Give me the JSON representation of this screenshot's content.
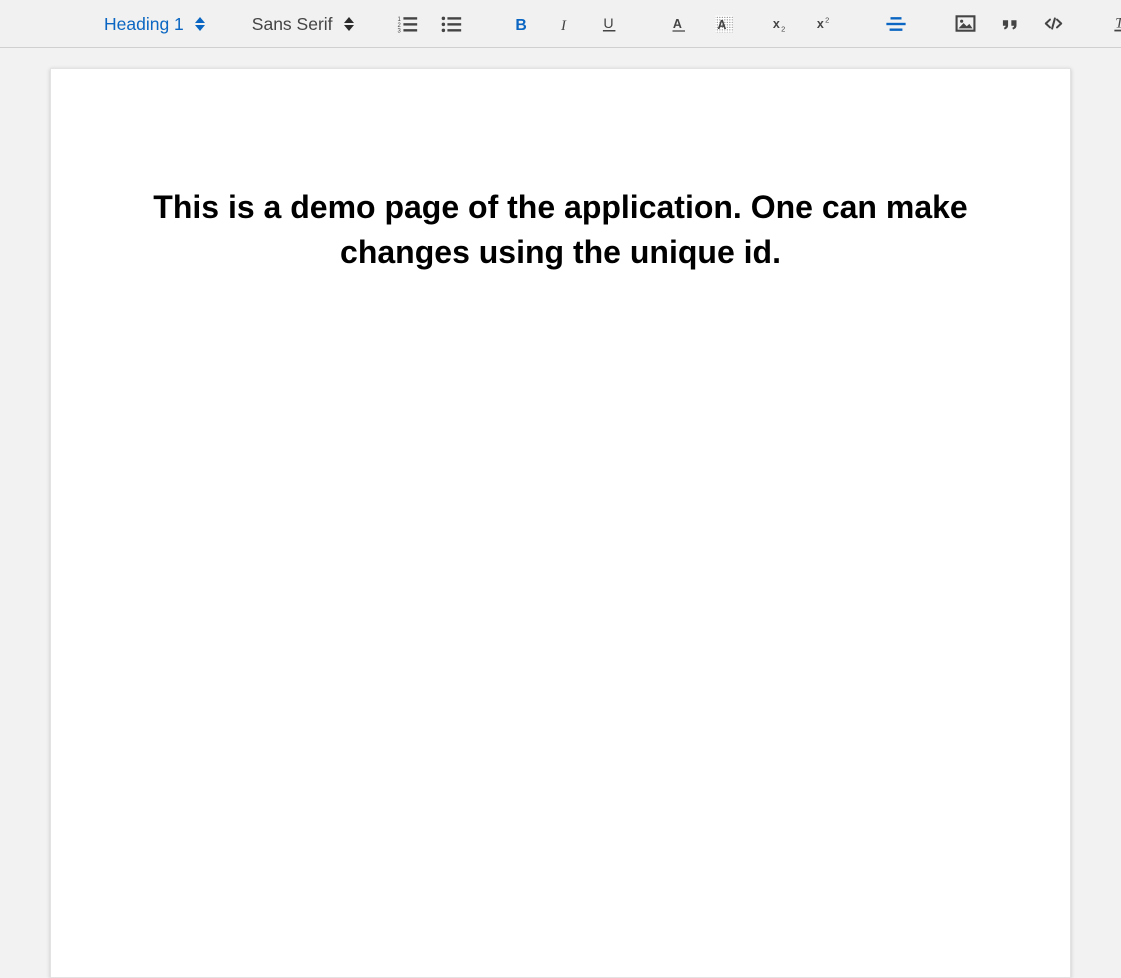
{
  "toolbar": {
    "header_picker": {
      "label": "Heading 1",
      "icon": "stepper-icon",
      "active": true,
      "color": "#0a66c2"
    },
    "font_picker": {
      "label": "Sans Serif",
      "icon": "stepper-icon",
      "active": false,
      "color": "#444444"
    },
    "buttons": [
      {
        "name": "ordered-list-button",
        "icon": "ordered-list-icon",
        "title": "Ordered List",
        "active": false
      },
      {
        "name": "bullet-list-button",
        "icon": "bullet-list-icon",
        "title": "Bullet List",
        "active": false
      },
      {
        "name": "bold-button",
        "icon": "bold-icon",
        "title": "Bold",
        "active": true
      },
      {
        "name": "italic-button",
        "icon": "italic-icon",
        "title": "Italic",
        "active": false
      },
      {
        "name": "underline-button",
        "icon": "underline-icon",
        "title": "Underline",
        "active": false
      },
      {
        "name": "text-color-button",
        "icon": "text-color-icon",
        "title": "Text Color",
        "active": false
      },
      {
        "name": "background-color-button",
        "icon": "background-color-icon",
        "title": "Background Color",
        "active": false
      },
      {
        "name": "subscript-button",
        "icon": "subscript-icon",
        "title": "Subscript",
        "active": false
      },
      {
        "name": "superscript-button",
        "icon": "superscript-icon",
        "title": "Superscript",
        "active": false
      },
      {
        "name": "align-center-button",
        "icon": "align-center-icon",
        "title": "Align Center",
        "active": true
      },
      {
        "name": "insert-image-button",
        "icon": "image-icon",
        "title": "Insert Image",
        "active": false
      },
      {
        "name": "blockquote-button",
        "icon": "blockquote-icon",
        "title": "Blockquote",
        "active": false
      },
      {
        "name": "code-block-button",
        "icon": "code-icon",
        "title": "Code Block",
        "active": false
      },
      {
        "name": "clear-format-button",
        "icon": "clear-format-icon",
        "title": "Clear Formatting",
        "active": false
      }
    ],
    "accent_color": "#0a66c2",
    "icon_color": "#444444",
    "background_color": "#f1f1f1"
  },
  "editor": {
    "heading_text": "This is a demo page of the application. One can make changes using the unique id.",
    "page_background": "#ffffff",
    "canvas_background": "#f2f2f2"
  }
}
